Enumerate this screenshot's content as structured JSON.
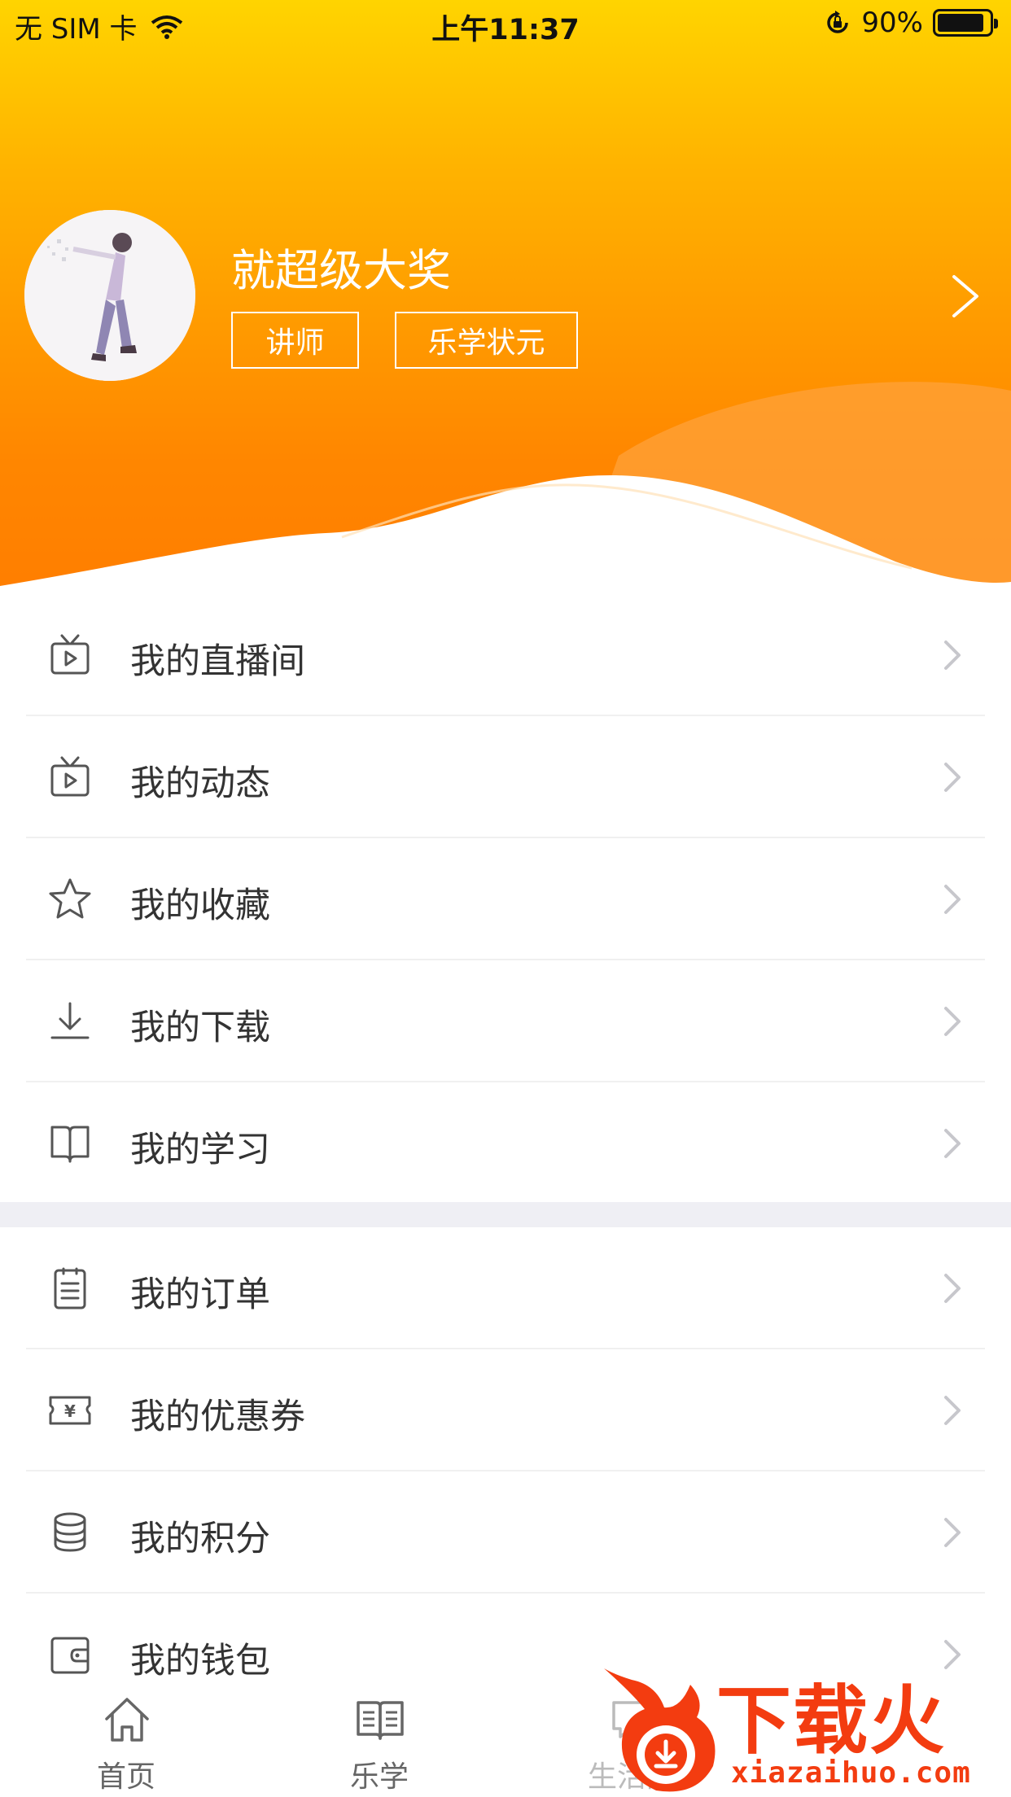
{
  "status_bar": {
    "carrier": "无 SIM 卡",
    "time": "上午11:37",
    "battery_percent": "90%",
    "battery_level": 0.9
  },
  "profile": {
    "username": "就超级大奖",
    "tags": [
      "讲师",
      "乐学状元"
    ]
  },
  "menu_group_1": [
    {
      "label": "我的直播间",
      "icon": "tv-play-icon"
    },
    {
      "label": "我的动态",
      "icon": "tv-play-icon"
    },
    {
      "label": "我的收藏",
      "icon": "star-icon"
    },
    {
      "label": "我的下载",
      "icon": "download-icon"
    },
    {
      "label": "我的学习",
      "icon": "open-book-icon"
    }
  ],
  "menu_group_2": [
    {
      "label": "我的订单",
      "icon": "clipboard-icon"
    },
    {
      "label": "我的优惠券",
      "icon": "coupon-icon"
    },
    {
      "label": "我的积分",
      "icon": "coins-icon"
    },
    {
      "label": "我的钱包",
      "icon": "wallet-icon"
    }
  ],
  "tabbar": [
    {
      "label": "首页",
      "icon": "home-icon"
    },
    {
      "label": "乐学",
      "icon": "book-icon"
    },
    {
      "label": "生活圈",
      "icon": "chat-icon"
    }
  ],
  "watermark": {
    "text": "下载火",
    "url": "xiazaihuo.com"
  },
  "colors": {
    "header_top": "#ffd400",
    "header_bottom": "#ff7e00",
    "watermark": "#f33c10"
  }
}
